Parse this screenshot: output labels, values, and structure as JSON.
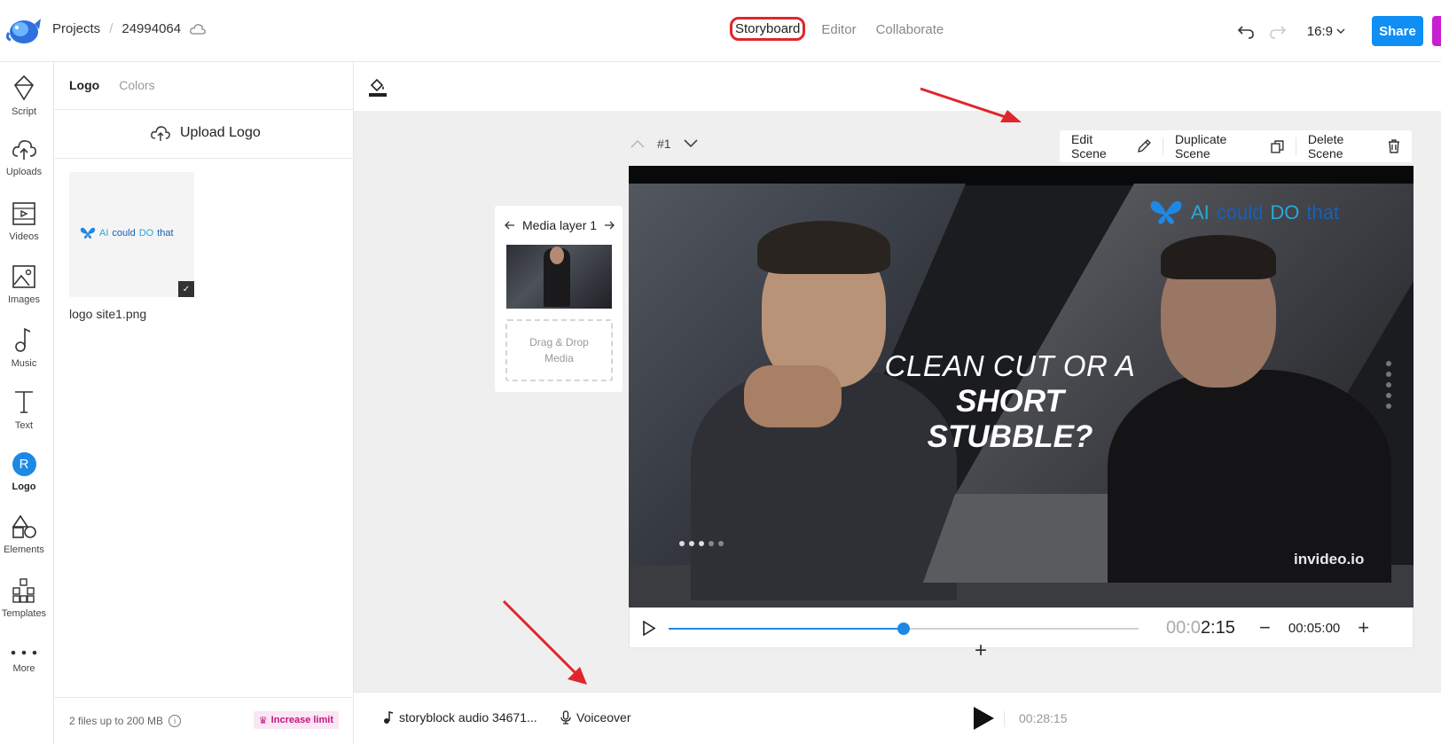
{
  "header": {
    "breadcrumb_root": "Projects",
    "breadcrumb_sep": "/",
    "project_id": "24994064",
    "modes": [
      {
        "label": "Storyboard",
        "active": true
      },
      {
        "label": "Editor",
        "active": false
      },
      {
        "label": "Collaborate",
        "active": false
      }
    ],
    "aspect_ratio": "16:9",
    "share_label": "Share"
  },
  "rail": {
    "items": [
      {
        "label": "Script",
        "icon": "script-icon"
      },
      {
        "label": "Uploads",
        "icon": "upload-cloud-icon"
      },
      {
        "label": "Videos",
        "icon": "video-icon"
      },
      {
        "label": "Images",
        "icon": "image-icon"
      },
      {
        "label": "Music",
        "icon": "music-note-icon"
      },
      {
        "label": "Text",
        "icon": "text-icon"
      },
      {
        "label": "Logo",
        "icon": "logo-avatar-icon",
        "active": true,
        "avatar_letter": "R"
      },
      {
        "label": "Elements",
        "icon": "elements-icon"
      },
      {
        "label": "Templates",
        "icon": "templates-icon"
      },
      {
        "label": "More",
        "icon": "more-dots-icon"
      }
    ]
  },
  "panel": {
    "tabs": [
      {
        "label": "Logo",
        "active": true
      },
      {
        "label": "Colors",
        "active": false
      }
    ],
    "upload_label": "Upload Logo",
    "logo_file": {
      "name": "logo site1.png",
      "thumb_text": {
        "w1": "AI",
        "w2": "could",
        "w3": "DO",
        "w4": "that"
      }
    },
    "footer_text": "2 files up to 200 MB",
    "increase_label": "Increase limit"
  },
  "scene": {
    "number": "#1",
    "actions": {
      "edit": "Edit Scene",
      "duplicate": "Duplicate Scene",
      "delete": "Delete Scene"
    },
    "media_layer_label": "Media layer 1",
    "drop_line1": "Drag & Drop",
    "drop_line2": "Media",
    "overlay": {
      "logo": {
        "w1": "AI",
        "w2": "could",
        "w3": "DO",
        "w4": "that"
      },
      "line1": "CLEAN CUT OR A",
      "line2": "SHORT STUBBLE?",
      "watermark": "invideo.io"
    },
    "player": {
      "progress": 0.5,
      "time_dim": "00:0",
      "time_main": "2:15",
      "duration": "00:05:00"
    }
  },
  "bottom": {
    "audio_label": "storyblock audio 34671...",
    "voiceover_label": "Voiceover",
    "total_time": "00:28:15"
  },
  "colors": {
    "accent": "#1e88e5",
    "share": "#0f8ef4",
    "highlight": "#e0262b",
    "increase": "#c1187f"
  }
}
